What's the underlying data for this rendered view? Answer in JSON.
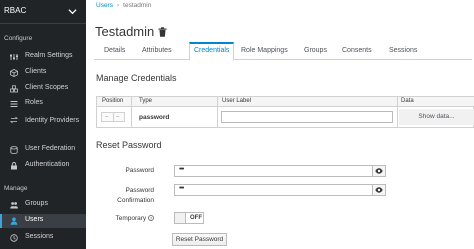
{
  "sidebar": {
    "realm": "RBAC",
    "configure_label": "Configure",
    "configure_items": [
      {
        "label": "Realm Settings",
        "icon": "sliders-icon"
      },
      {
        "label": "Clients",
        "icon": "cube-icon"
      },
      {
        "label": "Client Scopes",
        "icon": "cubes-icon"
      },
      {
        "label": "Roles",
        "icon": "list-icon"
      },
      {
        "label": "Identity Providers",
        "icon": "exchange-icon"
      },
      {
        "label": "User Federation",
        "icon": "database-icon"
      },
      {
        "label": "Authentication",
        "icon": "lock-icon"
      }
    ],
    "manage_label": "Manage",
    "manage_items": [
      {
        "label": "Groups",
        "icon": "users-icon"
      },
      {
        "label": "Users",
        "icon": "user-icon"
      },
      {
        "label": "Sessions",
        "icon": "clock-icon"
      }
    ]
  },
  "breadcrumb": {
    "parent": "Users",
    "current": "testadmin"
  },
  "page_title": "Testadmin",
  "tabs": [
    "Details",
    "Attributes",
    "Credentials",
    "Role Mappings",
    "Groups",
    "Consents",
    "Sessions"
  ],
  "active_tab": "Credentials",
  "manage_credentials": {
    "heading": "Manage Credentials",
    "columns": [
      "Position",
      "Type",
      "User Label",
      "Data"
    ],
    "row": {
      "type": "password",
      "user_label": "",
      "data_button": "Show data..."
    }
  },
  "reset_password": {
    "heading": "Reset Password",
    "password_label": "Password",
    "password_value": "•••",
    "confirm_label_1": "Password",
    "confirm_label_2": "Confirmation",
    "confirm_value": "•••",
    "temporary_label": "Temporary",
    "toggle_state": "OFF",
    "submit_label": "Reset Password"
  },
  "colors": {
    "sidebar_bg": "#212427",
    "accent": "#0088ce",
    "active_nav": "#393f44"
  }
}
